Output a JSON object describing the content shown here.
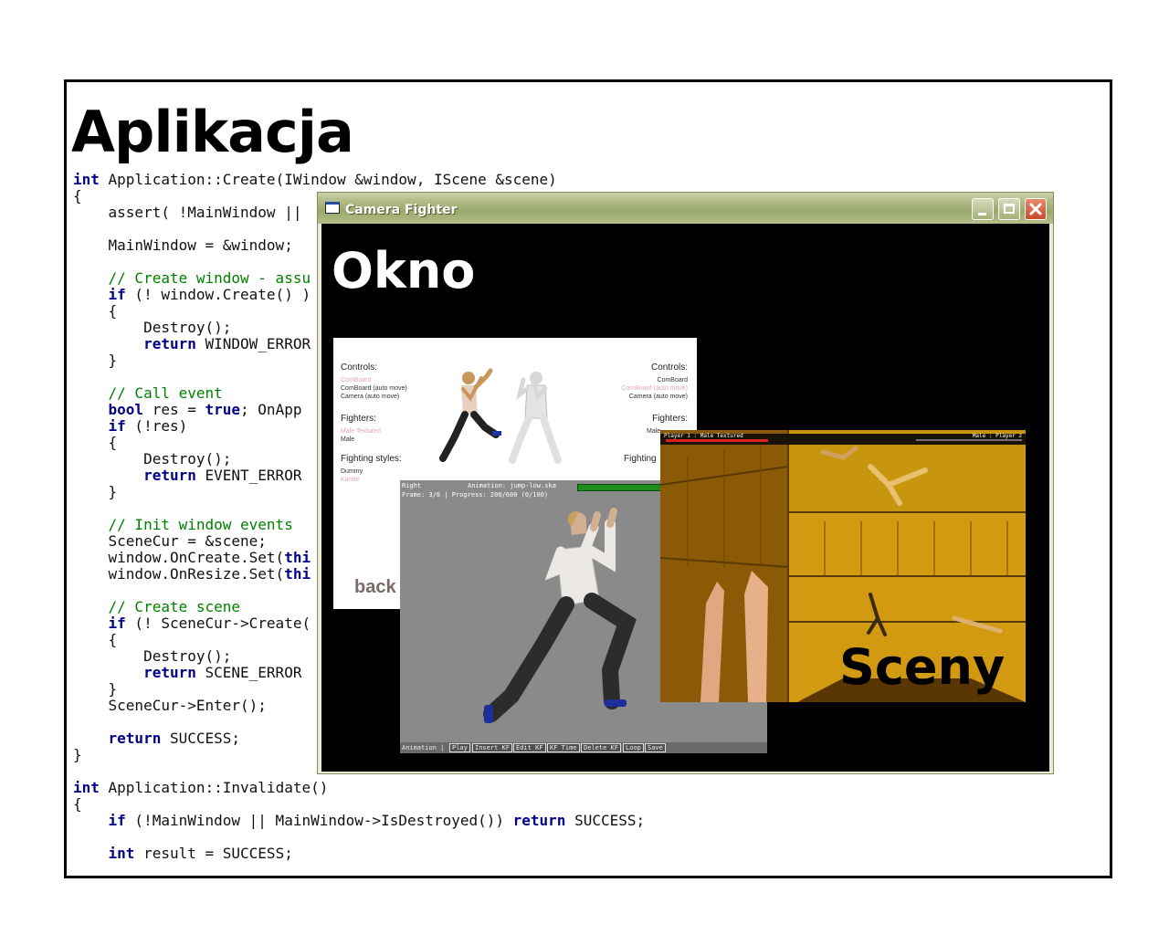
{
  "slide": {
    "title": "Aplikacja",
    "code_lines": [
      [
        {
          "t": "int",
          "c": "kw"
        },
        {
          "t": " Application::Create(IWindow &window, IScene &scene)"
        }
      ],
      [
        {
          "t": "{"
        }
      ],
      [
        {
          "t": "    assert( !MainWindow || "
        }
      ],
      [
        {
          "t": ""
        }
      ],
      [
        {
          "t": "    MainWindow = &window;"
        }
      ],
      [
        {
          "t": ""
        }
      ],
      [
        {
          "t": "    // Create window - assu",
          "c": "cm"
        }
      ],
      [
        {
          "t": "    "
        },
        {
          "t": "if",
          "c": "kw"
        },
        {
          "t": " (! window.Create() )"
        }
      ],
      [
        {
          "t": "    {"
        }
      ],
      [
        {
          "t": "        Destroy();"
        }
      ],
      [
        {
          "t": "        "
        },
        {
          "t": "return",
          "c": "kw"
        },
        {
          "t": " WINDOW_ERROR"
        }
      ],
      [
        {
          "t": "    }"
        }
      ],
      [
        {
          "t": ""
        }
      ],
      [
        {
          "t": "    // Call event",
          "c": "cm"
        }
      ],
      [
        {
          "t": "    "
        },
        {
          "t": "bool",
          "c": "kw"
        },
        {
          "t": " res = "
        },
        {
          "t": "true",
          "c": "kw"
        },
        {
          "t": "; OnApp"
        }
      ],
      [
        {
          "t": "    "
        },
        {
          "t": "if",
          "c": "kw"
        },
        {
          "t": " (!res)"
        }
      ],
      [
        {
          "t": "    {"
        }
      ],
      [
        {
          "t": "        Destroy();"
        }
      ],
      [
        {
          "t": "        "
        },
        {
          "t": "return",
          "c": "kw"
        },
        {
          "t": " EVENT_ERROR"
        }
      ],
      [
        {
          "t": "    }"
        }
      ],
      [
        {
          "t": ""
        }
      ],
      [
        {
          "t": "    // Init window events",
          "c": "cm"
        }
      ],
      [
        {
          "t": "    SceneCur = &scene;"
        }
      ],
      [
        {
          "t": "    window.OnCreate.Set("
        },
        {
          "t": "thi",
          "c": "kw"
        }
      ],
      [
        {
          "t": "    window.OnResize.Set("
        },
        {
          "t": "thi",
          "c": "kw"
        }
      ],
      [
        {
          "t": ""
        }
      ],
      [
        {
          "t": "    // Create scene",
          "c": "cm"
        }
      ],
      [
        {
          "t": "    "
        },
        {
          "t": "if",
          "c": "kw"
        },
        {
          "t": " (! SceneCur->Create("
        }
      ],
      [
        {
          "t": "    {"
        }
      ],
      [
        {
          "t": "        Destroy();"
        }
      ],
      [
        {
          "t": "        "
        },
        {
          "t": "return",
          "c": "kw"
        },
        {
          "t": " SCENE_ERROR"
        }
      ],
      [
        {
          "t": "    }"
        }
      ],
      [
        {
          "t": "    SceneCur->Enter();"
        }
      ],
      [
        {
          "t": ""
        }
      ],
      [
        {
          "t": "    "
        },
        {
          "t": "return",
          "c": "kw"
        },
        {
          "t": " SUCCESS;"
        }
      ],
      [
        {
          "t": "}"
        }
      ],
      [
        {
          "t": ""
        }
      ],
      [
        {
          "t": "int",
          "c": "kw"
        },
        {
          "t": " Application::Invalidate()"
        }
      ],
      [
        {
          "t": "{"
        }
      ],
      [
        {
          "t": "    "
        },
        {
          "t": "if",
          "c": "kw"
        },
        {
          "t": " (!MainWindow || MainWindow->IsDestroyed()) "
        },
        {
          "t": "return",
          "c": "kw"
        },
        {
          "t": " SUCCESS;"
        }
      ],
      [
        {
          "t": ""
        }
      ],
      [
        {
          "t": "    "
        },
        {
          "t": "int",
          "c": "kw"
        },
        {
          "t": " result = SUCCESS;"
        }
      ]
    ]
  },
  "window": {
    "title": "Camera Fighter",
    "overlay_label": "Okno",
    "buttons": {
      "minimize_icon": "minimize-icon",
      "maximize_icon": "maximize-icon",
      "close_icon": "close-icon"
    }
  },
  "menu_screen": {
    "left_controls_heading": "Controls:",
    "left_controls": [
      "ComBoard",
      "ComBoard (auto move)",
      "Camera (auto move)"
    ],
    "right_controls_heading": "Controls:",
    "right_controls": [
      "ComBoard",
      "ComBoard (auto move)",
      "Camera (auto move)"
    ],
    "left_fighters_heading": "Fighters:",
    "left_fighters": [
      "Male Textured",
      "Male"
    ],
    "right_fighters_heading": "Fighters:",
    "right_fighters_partial": "Male",
    "styles_heading": "Fighting styles:",
    "right_styles_partial": "Fighting",
    "styles": [
      "Dummy",
      "Karate"
    ],
    "back_label": "back"
  },
  "editor_screen": {
    "side": "Right",
    "animation": "Animation: jump-low.ska",
    "frame": "Frame: 3/6 | Progress: 200/600 (0/100)",
    "toolbar_label": "Animation |",
    "toolbar_buttons": [
      "Play",
      "Insert KF",
      "Edit KF",
      "KF Time",
      "Delete KF",
      "Loop",
      "Save"
    ]
  },
  "scene_screen": {
    "player1": "Player 1 : Male Textured",
    "player2": "Male : Player 2",
    "overlay_label": "Sceny"
  },
  "colors": {
    "keyword": "#00008b",
    "comment": "#008000",
    "titlebar": "#a8b47c",
    "scene_tint": "#c8920a"
  }
}
